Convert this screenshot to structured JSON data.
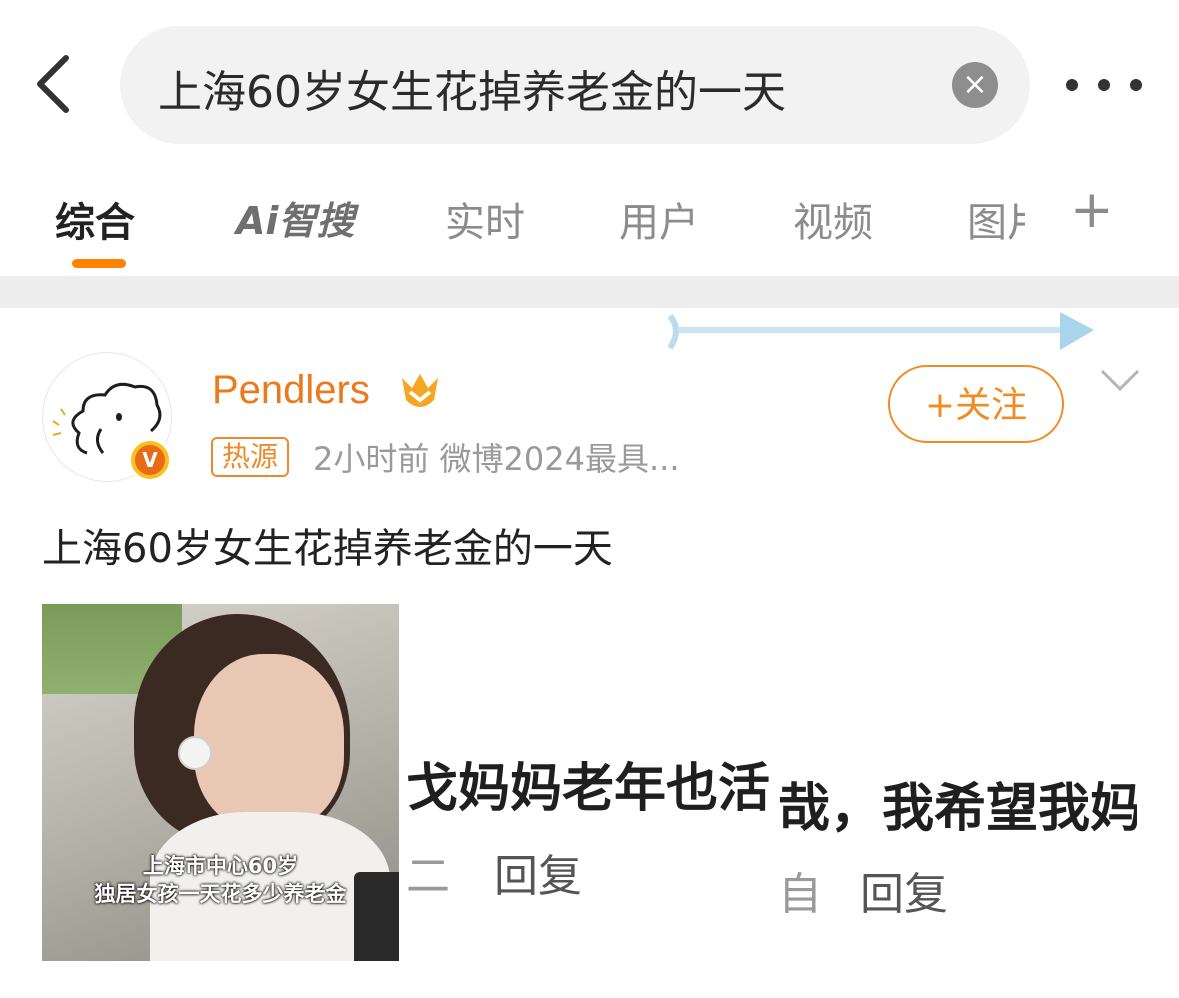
{
  "search": {
    "query": "上海60岁女生花掉养老金的一天",
    "clear_icon": "×"
  },
  "tabs": [
    {
      "label": "综合",
      "active": true
    },
    {
      "label": "Ai智搜",
      "active": false
    },
    {
      "label": "实时",
      "active": false
    },
    {
      "label": "用户",
      "active": false
    },
    {
      "label": "视频",
      "active": false
    },
    {
      "label": "图片",
      "active": false
    }
  ],
  "tabs_visible": {
    "tab5": "图."
  },
  "tab_add_icon": "+",
  "accent_color": "#ff8200",
  "post": {
    "username": "Pendlers",
    "verified_badge": "V",
    "source_badge": "热源",
    "meta": "2小时前  微博2024最具...",
    "follow_label": "+关注",
    "text": "上海60岁女生花掉养老金的一天",
    "media": {
      "caption_line1": "上海市中心60岁",
      "caption_line2": "独居女孩一天花多少养老金",
      "mid_text": "戈妈妈老年也活",
      "mid_fragment": "二",
      "mid_reply": "回复",
      "right_text": "哉，我希望我妈",
      "right_fragment": "自",
      "right_reply": "回复"
    }
  }
}
